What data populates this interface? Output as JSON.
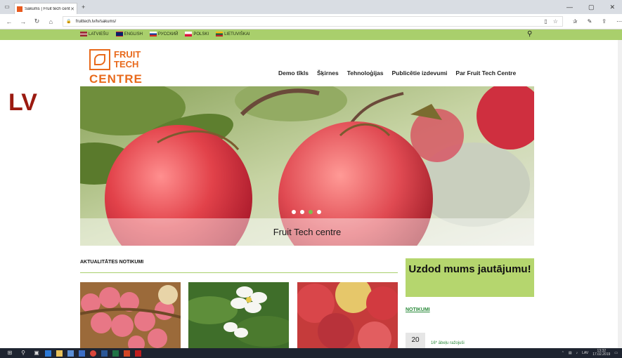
{
  "browser": {
    "tab_title": "Sākums | Fruit tech centr",
    "tab_close": "✕",
    "url": "fruittech.lv/lv/sakums/",
    "new_tab": "+",
    "window_controls": [
      "—",
      "▢",
      "✕"
    ]
  },
  "site": {
    "languages": [
      {
        "label": "Latviešu",
        "flag": [
          "#9e3039",
          "#ffffff",
          "#9e3039"
        ]
      },
      {
        "label": "English",
        "flag": [
          "#012169",
          "#ffffff",
          "#c8102e"
        ]
      },
      {
        "label": "Русский",
        "flag": [
          "#ffffff",
          "#0039a6",
          "#d52b1e"
        ]
      },
      {
        "label": "Polski",
        "flag": [
          "#ffffff",
          "#dc143c",
          "#dc143c"
        ]
      },
      {
        "label": "Lietuviškai",
        "flag": [
          "#fdb913",
          "#006a44",
          "#c1272d"
        ]
      }
    ],
    "logo": {
      "line1": "FRUIT",
      "line2": "TECH",
      "line3": "CENTRE"
    },
    "nav": [
      "Demo tīkls",
      "Šķirnes",
      "Tehnoloģijas",
      "Publicētie izdevumi",
      "Par Fruit Tech Centre"
    ],
    "side_label": "LV",
    "hero_caption": "Fruit Tech centre",
    "slider_dots": 4,
    "slider_active": 2,
    "news_heading": "AKTUALITĀTES NOTIKUMI",
    "ask_box": "Uzdod mums jautājumu!",
    "events_heading": "NOTIKUMI",
    "event_date": "20",
    "event_text": "16* ābeļu ražojuši",
    "colors": {
      "accent_green": "#a9cf6c",
      "brand_orange": "#e86a1c",
      "lv_red": "#9b1a10"
    }
  },
  "taskbar": {
    "time": "13:32",
    "date": "17.02.2019",
    "lang": "LAV"
  }
}
